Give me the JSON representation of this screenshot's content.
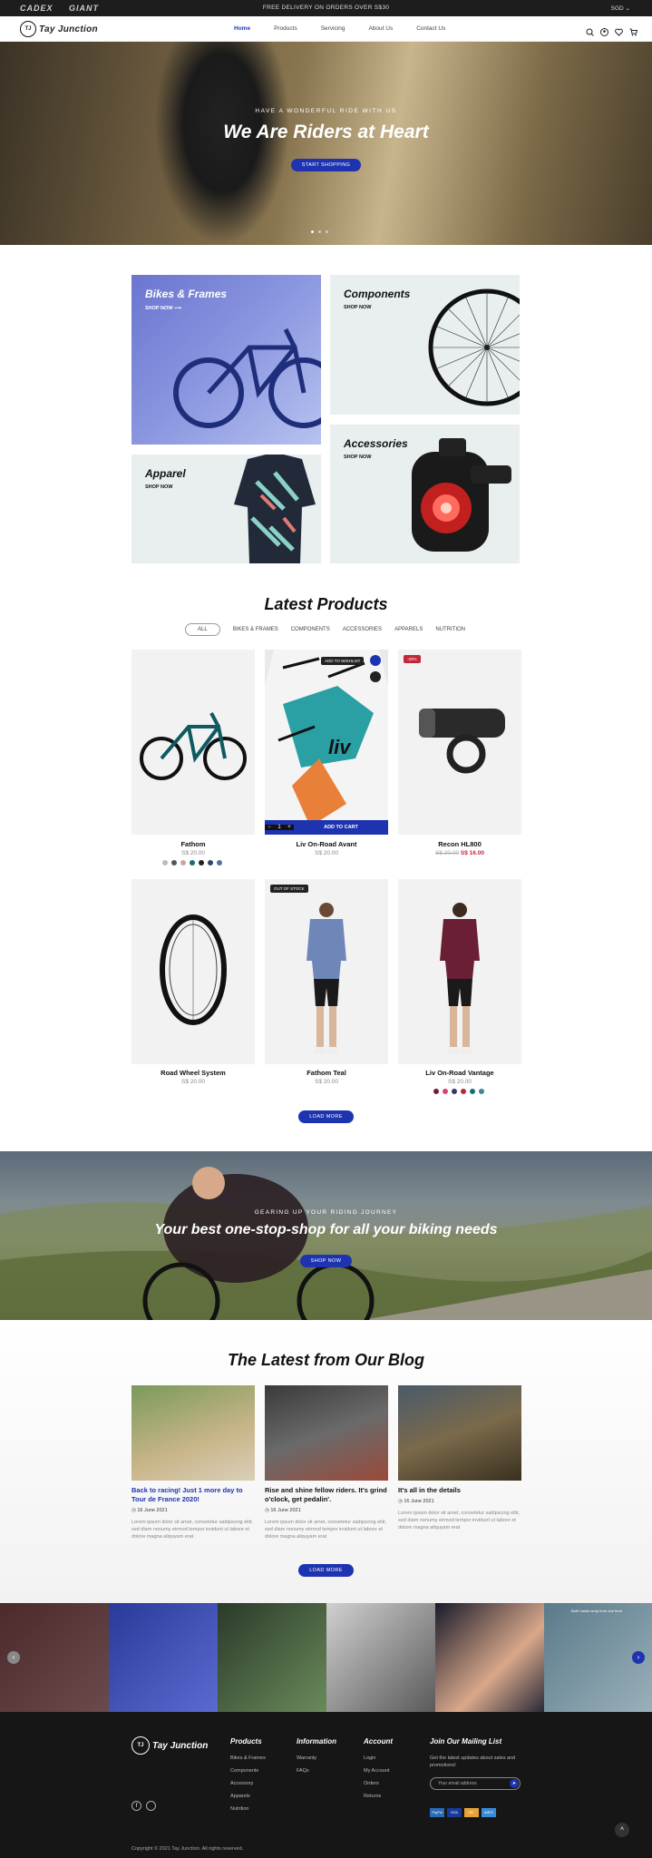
{
  "topbar": {
    "brand1": "CADEX",
    "brand2": "GIANT",
    "promo": "FREE DELIVERY ON ORDERS OVER S$30",
    "currency": "SGD"
  },
  "header": {
    "logo_mark": "TJ",
    "logo_text": "Tay Junction",
    "nav": [
      "Home",
      "Products",
      "Servicing",
      "About Us",
      "Contact Us"
    ]
  },
  "hero": {
    "eyebrow": "HAVE A WONDERFUL RIDE WITH US",
    "title": "We Are Riders at Heart",
    "cta": "START SHOPPING"
  },
  "categories": [
    {
      "title": "Bikes & Frames",
      "link": "SHOP NOW"
    },
    {
      "title": "Components",
      "link": "SHOP NOW"
    },
    {
      "title": "Apparel",
      "link": "SHOP NOW"
    },
    {
      "title": "Accessories",
      "link": "SHOP NOW"
    }
  ],
  "products_section": {
    "title": "Latest Products",
    "tabs": [
      "ALL",
      "BIKES & FRAMES",
      "COMPONENTS",
      "ACCESSORIES",
      "APPARELS",
      "NUTRITION"
    ],
    "load_more": "LOAD MORE"
  },
  "products": [
    {
      "name": "Fathom",
      "price": "S$ 20.00",
      "swatches": [
        "#bdbdbd",
        "#555555",
        "#c9a89a",
        "#1c6b72",
        "#222222",
        "#2a4a6a",
        "#5a6fa0"
      ]
    },
    {
      "name": "Liv On-Road Avant",
      "price": "S$ 20.00",
      "tag_wishlist": "ADD TO WISHLIST",
      "add_to_cart": "ADD TO CART",
      "qty_minus": "−",
      "qty": "1",
      "qty_plus": "+"
    },
    {
      "name": "Recon HL800",
      "old_price": "S$ 20.00",
      "price": "S$ 16.00",
      "badge": "-20%"
    },
    {
      "name": "Road Wheel System",
      "price": "S$ 20.00"
    },
    {
      "name": "Fathom Teal",
      "price": "S$ 20.00",
      "badge": "OUT OF STOCK"
    },
    {
      "name": "Liv On-Road Vantage",
      "price": "S$ 20.00",
      "swatches": [
        "#6b1f35",
        "#d9456a",
        "#333a6a",
        "#b8283a",
        "#1d6e6e",
        "#3d8a9a"
      ]
    }
  ],
  "banner": {
    "eyebrow": "GEARING UP YOUR RIDING JOURNEY",
    "title": "Your best one-stop-shop for all your biking needs",
    "cta": "SHOP NOW"
  },
  "blog": {
    "title": "The Latest from Our Blog",
    "load_more": "LOAD MORE",
    "posts": [
      {
        "title": "Back to racing! Just 1 more day to Tour de France 2020!",
        "date": "16 June 2021",
        "excerpt": "Lorem ipsum dolor sit amet, consetetur sadipscing elitr, sed diam nonumy eirmod tempor invidunt ut labore et dolore magna aliquyam erat"
      },
      {
        "title": "Rise and shine fellow riders. It's grind o'clock, get pedalin'.",
        "date": "16 June 2021",
        "excerpt": "Lorem ipsum dolor sit amet, consetetur sadipscing elitr, sed diam nonumy eirmod tempor invidunt ut labore et dolore magna aliquyam erat"
      },
      {
        "title": "It's all in the details",
        "date": "16 June 2021",
        "excerpt": "Lorem ipsum dolor sit amet, consetetur sadipscing elitr, sed diam nonumy eirmod tempor invidunt ut labore et dolore magna aliquyam erat"
      }
    ]
  },
  "instagram": {
    "caption": "Both hands wrap from one form"
  },
  "footer": {
    "logo_mark": "TJ",
    "logo_text": "Tay Junction",
    "products_title": "Products",
    "products": [
      "Bikes & Frames",
      "Components",
      "Accessory",
      "Apparels",
      "Nutrition"
    ],
    "info_title": "Information",
    "info": [
      "Warranty",
      "FAQs"
    ],
    "account_title": "Account",
    "account": [
      "Login",
      "My Account",
      "Orders",
      "Returns"
    ],
    "mailing_title": "Join Our Mailing List",
    "mailing_text": "Get the latest updates about sales and promotions!",
    "email_placeholder": "Your email address",
    "payments": [
      "PayPal",
      "VISA",
      "MC",
      "AMEX"
    ],
    "copyright": "Copyright © 2021 Tay Junction. All rights reserved."
  },
  "colors": {
    "accent": "#1e33b0",
    "sale": "#c0283c",
    "dark": "#161616"
  }
}
